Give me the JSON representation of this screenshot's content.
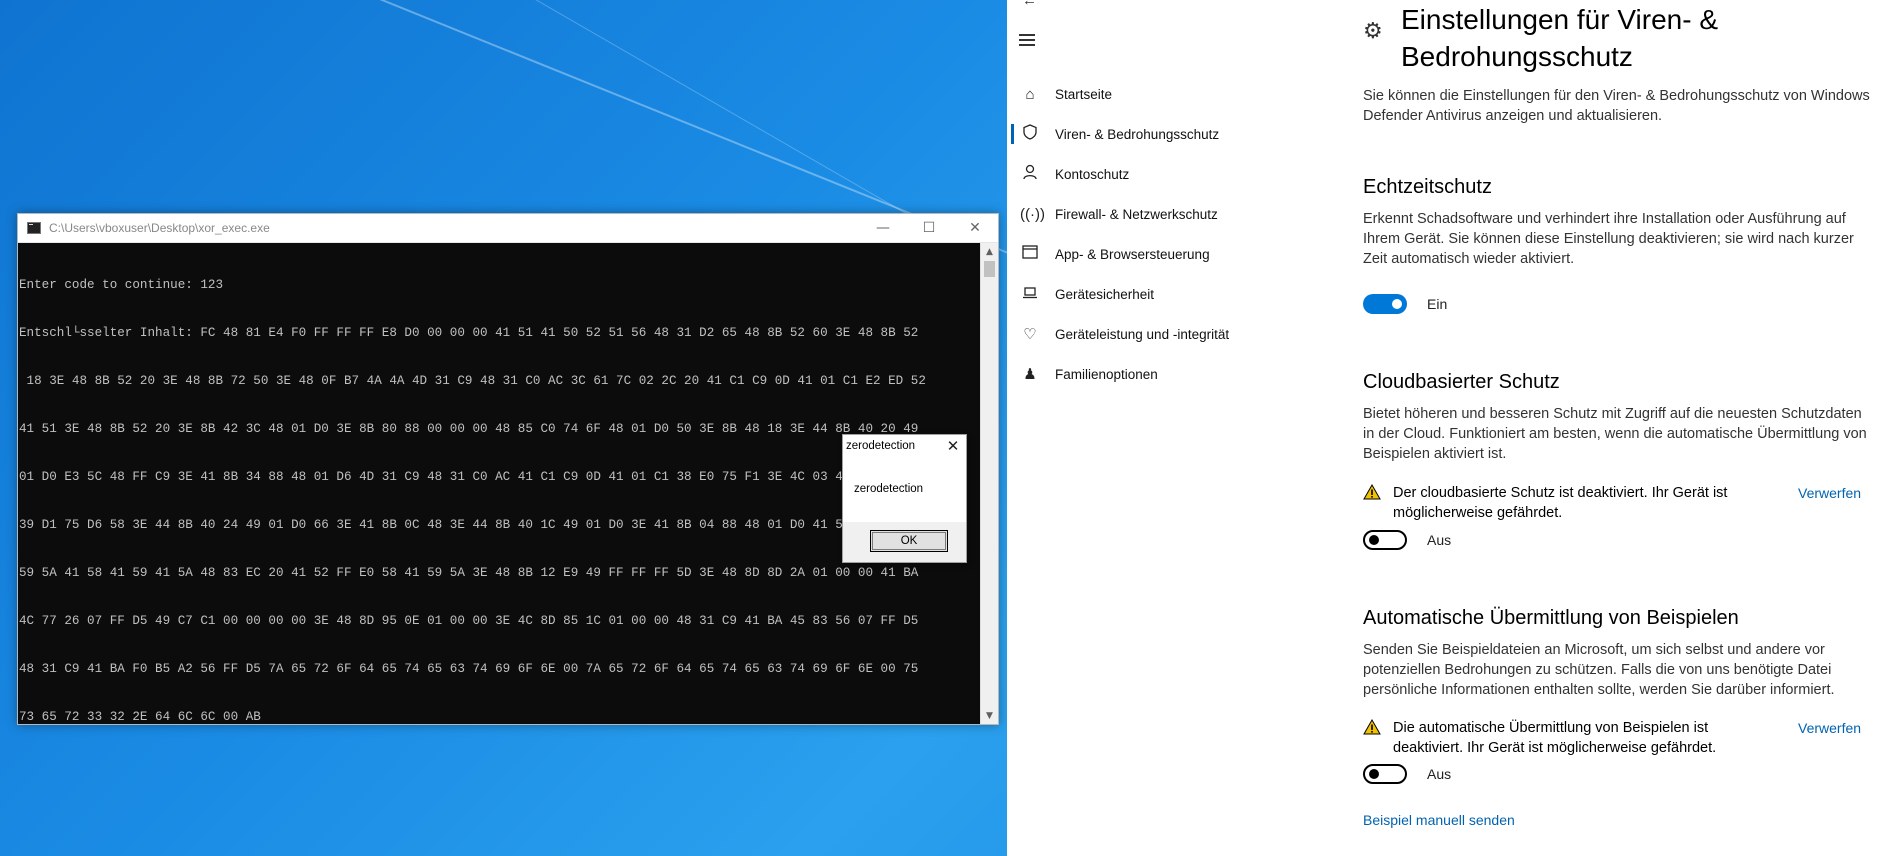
{
  "console": {
    "title": "C:\\Users\\vboxuser\\Desktop\\xor_exec.exe",
    "lines": [
      "Enter code to continue: 123",
      "Entschl└sselter Inhalt: FC 48 81 E4 F0 FF FF FF E8 D0 00 00 00 41 51 41 50 52 51 56 48 31 D2 65 48 8B 52 60 3E 48 8B 52",
      " 18 3E 48 8B 52 20 3E 48 8B 72 50 3E 48 0F B7 4A 4A 4D 31 C9 48 31 C0 AC 3C 61 7C 02 2C 20 41 C1 C9 0D 41 01 C1 E2 ED 52",
      "41 51 3E 48 8B 52 20 3E 8B 42 3C 48 01 D0 3E 8B 80 88 00 00 00 48 85 C0 74 6F 48 01 D0 50 3E 8B 48 18 3E 44 8B 40 20 49",
      "01 D0 E3 5C 48 FF C9 3E 41 8B 34 88 48 01 D6 4D 31 C9 48 31 C0 AC 41 C1 C9 0D 41 01 C1 38 E0 75 F1 3E 4C 03 4C 24 08 45",
      "39 D1 75 D6 58 3E 44 8B 40 24 49 01 D0 66 3E 41 8B 0C 48 3E 44 8B 40 1C 49 01 D0 3E 41 8B 04 88 48 01 D0 41 58 41 58 5E",
      "59 5A 41 58 41 59 41 5A 48 83 EC 20 41 52 FF E0 58 41 59 5A 3E 48 8B 12 E9 49 FF FF FF 5D 3E 48 8D 8D 2A 01 00 00 41 BA",
      "4C 77 26 07 FF D5 49 C7 C1 00 00 00 00 3E 48 8D 95 0E 01 00 00 3E 4C 8D 85 1C 01 00 00 48 31 C9 41 BA 45 83 56 07 FF D5",
      "48 31 C9 41 BA F0 B5 A2 56 FF D5 7A 65 72 6F 64 65 74 65 63 74 69 6F 6E 00 7A 65 72 6F 64 65 74 65 63 74 69 6F 6E 00 75",
      "73 65 72 33 32 2E 64 6C 6C 00 AB"
    ]
  },
  "msgbox": {
    "title": "zerodetection",
    "message": "zerodetection",
    "ok_label": "OK"
  },
  "settings": {
    "nav": [
      {
        "label": "Startseite",
        "icon": "home-icon"
      },
      {
        "label": "Viren- & Bedrohungsschutz",
        "icon": "shield-icon",
        "active": true
      },
      {
        "label": "Kontoschutz",
        "icon": "person-icon"
      },
      {
        "label": "Firewall- & Netzwerkschutz",
        "icon": "antenna-icon"
      },
      {
        "label": "App- & Browsersteuerung",
        "icon": "browser-icon"
      },
      {
        "label": "Gerätesicherheit",
        "icon": "laptop-icon"
      },
      {
        "label": "Geräteleistung und -integrität",
        "icon": "heart-icon"
      },
      {
        "label": "Familienoptionen",
        "icon": "family-icon"
      }
    ],
    "title": "Einstellungen für Viren- & Bedrohungsschutz",
    "intro": "Sie können die Einstellungen für den Viren- & Bedrohungsschutz von Windows Defender Antivirus anzeigen und aktualisieren.",
    "realtime": {
      "heading": "Echtzeitschutz",
      "desc": "Erkennt Schadsoftware und verhindert ihre Installation oder Ausführung auf Ihrem Gerät. Sie können diese Einstellung deaktivieren; sie wird nach kurzer Zeit automatisch wieder aktiviert.",
      "state": "Ein"
    },
    "cloud": {
      "heading": "Cloudbasierter Schutz",
      "desc": "Bietet höheren und besseren Schutz mit Zugriff auf die neuesten Schutzdaten in der Cloud. Funktioniert am besten, wenn die automatische Übermittlung von Beispielen aktiviert ist.",
      "warning": "Der cloudbasierte Schutz ist deaktiviert. Ihr Gerät ist möglicherweise gefährdet.",
      "dismiss": "Verwerfen",
      "state": "Aus"
    },
    "samples": {
      "heading": "Automatische Übermittlung von Beispielen",
      "desc": "Senden Sie Beispieldateien an Microsoft, um sich selbst und andere vor potenziellen Bedrohungen zu schützen. Falls die von uns benötigte Datei persönliche Informationen enthalten sollte, werden Sie darüber informiert.",
      "warning": "Die automatische Übermittlung von Beispielen ist deaktiviert. Ihr Gerät ist möglicherweise gefährdet.",
      "dismiss": "Verwerfen",
      "state": "Aus",
      "manual_link": "Beispiel manuell senden"
    }
  }
}
